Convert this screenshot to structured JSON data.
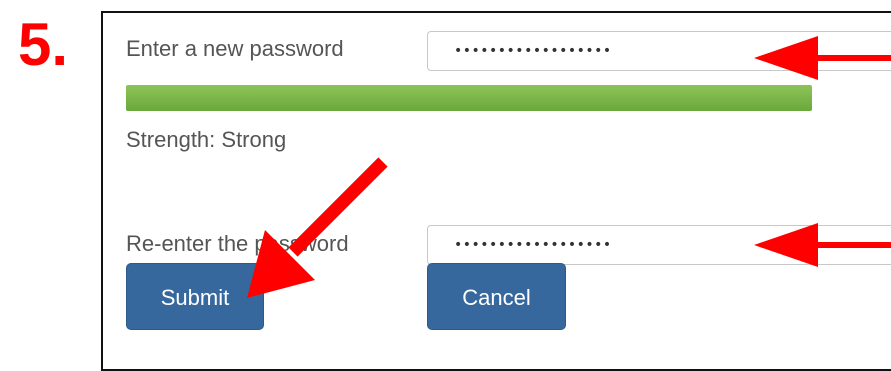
{
  "step": {
    "number": "5."
  },
  "form": {
    "new_password_label": "Enter a new password",
    "new_password_value": "••••••••••••••••••",
    "strength_text": "Strength: Strong",
    "strength_level": 1.0,
    "reenter_label": "Re-enter the password",
    "reenter_value": "••••••••••••••••••",
    "submit_label": "Submit",
    "cancel_label": "Cancel"
  },
  "colors": {
    "step_number": "#ff0000",
    "arrow": "#ff0000",
    "strength_fill": "#7ab648",
    "button": "#36689e"
  },
  "annotations": {
    "arrow_icon": "arrow-icon"
  }
}
